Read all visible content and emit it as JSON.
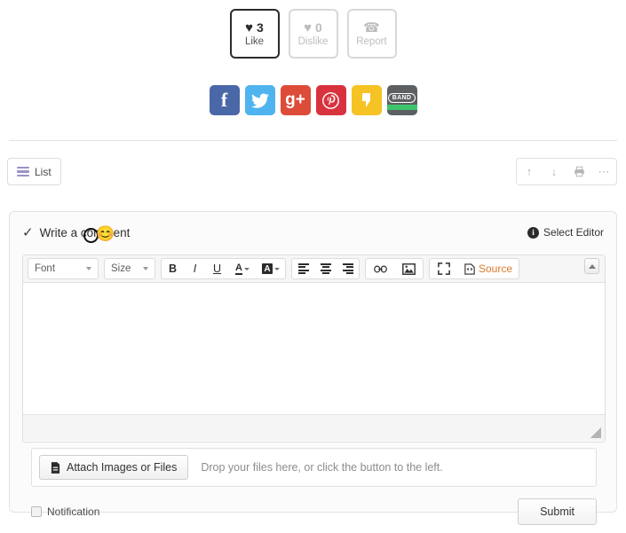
{
  "reactions": [
    {
      "icon": "heart-icon",
      "glyph": "♥",
      "count": "3",
      "label": "Like",
      "state": "active"
    },
    {
      "icon": "heart-icon",
      "glyph": "♥",
      "count": "0",
      "label": "Dislike",
      "state": "muted"
    },
    {
      "icon": "phone-icon",
      "glyph": "☎",
      "count": "",
      "label": "Report",
      "state": "muted"
    }
  ],
  "social": [
    {
      "name": "facebook-share",
      "glyph": "f",
      "color": "#4a68a8"
    },
    {
      "name": "twitter-share",
      "glyph": "✓",
      "color": "#4fb3f0"
    },
    {
      "name": "googleplus-share",
      "glyph": "g+",
      "color": "#dd4b39"
    },
    {
      "name": "pinterest-share",
      "glyph": "Ⓟ",
      "color": "#d9323f"
    },
    {
      "name": "kakaostory-share",
      "glyph": "”",
      "color": "#f6c324"
    },
    {
      "name": "band-share",
      "glyph": "BAND",
      "color": "#5c6063"
    }
  ],
  "nav": {
    "list_label": "List",
    "tools": [
      {
        "name": "move-up-icon",
        "glyph": "↑"
      },
      {
        "name": "move-down-icon",
        "glyph": "↓"
      },
      {
        "name": "print-icon",
        "glyph": "⎙"
      },
      {
        "name": "more-icon",
        "glyph": "⋯"
      }
    ]
  },
  "comment": {
    "check_glyph": "✓",
    "title": "Write a comment",
    "emoji": "😊",
    "select_editor_label": "Select Editor",
    "info_glyph": "i"
  },
  "editor": {
    "font_label": "Font",
    "size_label": "Size",
    "bold_glyph": "B",
    "italic_glyph": "I",
    "underline_glyph": "U",
    "text_color_glyph": "A",
    "bg_color_glyph": "A",
    "link_glyph": "⚭",
    "image_glyph": "🖼",
    "fullscreen_glyph": "⛶",
    "source_glyph": "◇",
    "source_label": "Source",
    "content": ""
  },
  "attach": {
    "button_label": "Attach Images or Files",
    "file_glyph": "🗎",
    "hint": "Drop your files here, or click the button to the left."
  },
  "footer": {
    "notification_label": "Notification",
    "notification_checked": false,
    "submit_label": "Submit"
  }
}
